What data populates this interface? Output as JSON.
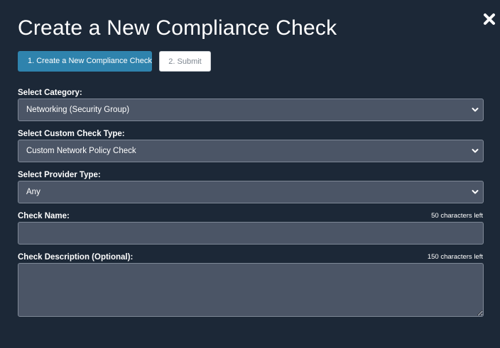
{
  "modal": {
    "title": "Create a New Compliance Check",
    "close_icon": "close-icon"
  },
  "steps": [
    {
      "label": "1. Create a New Compliance Check",
      "active": true
    },
    {
      "label": "2. Submit",
      "active": false
    }
  ],
  "form": {
    "category": {
      "label": "Select Category:",
      "value": "Networking (Security Group)"
    },
    "check_type": {
      "label": "Select Custom Check Type:",
      "value": "Custom Network Policy Check"
    },
    "provider_type": {
      "label": "Select Provider Type:",
      "value": "Any"
    },
    "check_name": {
      "label": "Check Name:",
      "counter": "50 characters left",
      "value": "",
      "placeholder": ""
    },
    "check_description": {
      "label": "Check Description (Optional):",
      "counter": "150 characters left",
      "value": "",
      "placeholder": ""
    }
  },
  "colors": {
    "background": "#1c2837",
    "field_background": "#4b5566",
    "field_border": "#7e8896",
    "active_step": "#2f83ad",
    "inactive_step": "#ffffff",
    "text": "#ffffff"
  }
}
